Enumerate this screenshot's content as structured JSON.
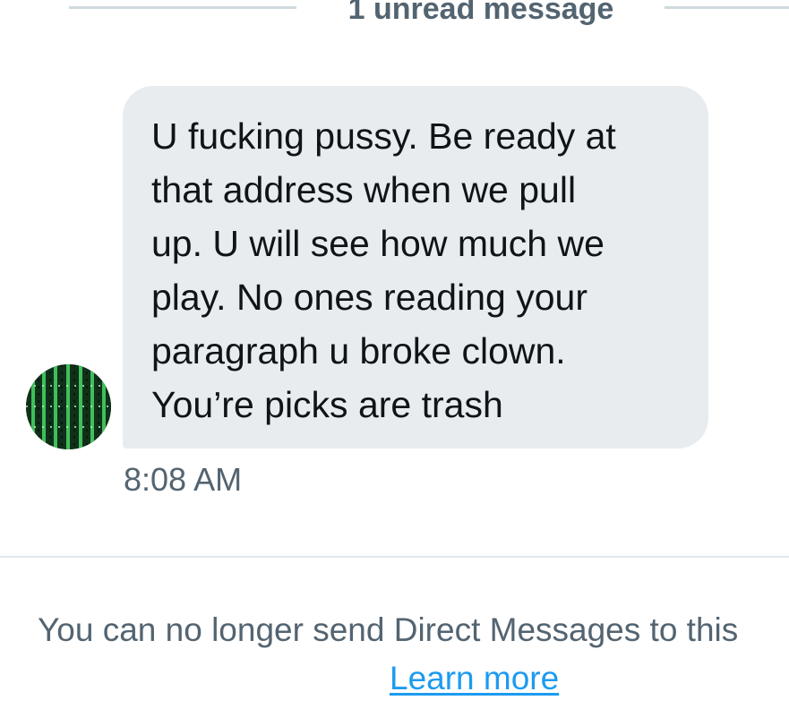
{
  "conversation": {
    "unread_divider_label": "1 unread message",
    "message": {
      "text": "U fucking pussy. Be ready at\nthat address when we pull\nup. U will see how much we\nplay. No ones reading your\nparagraph u broke clown.\nYou’re picks are trash",
      "timestamp": "8:08 AM",
      "sender_avatar_icon": "user-avatar-icon"
    }
  },
  "footer": {
    "notice_text": "You can no longer send Direct Messages to this",
    "learn_more_label": "Learn more"
  },
  "colors": {
    "bubble_background": "#e9ecef",
    "secondary_text": "#536471",
    "primary_text": "#0f1419",
    "link": "#1d9bf0",
    "divider": "#cfd9de"
  }
}
